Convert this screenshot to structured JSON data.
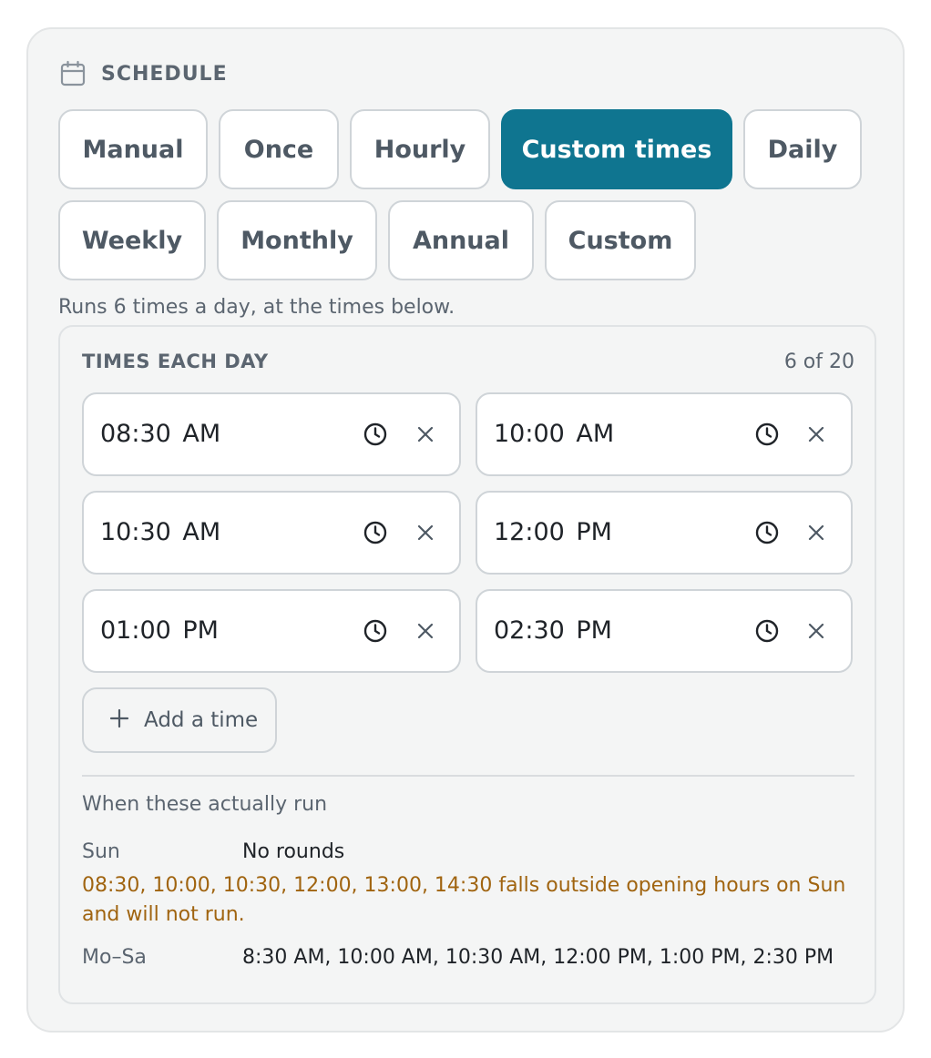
{
  "header": {
    "title": "SCHEDULE",
    "icon": "calendar-icon"
  },
  "frequency_options": [
    {
      "label": "Manual",
      "selected": false
    },
    {
      "label": "Once",
      "selected": false
    },
    {
      "label": "Hourly",
      "selected": false
    },
    {
      "label": "Custom times",
      "selected": true
    },
    {
      "label": "Daily",
      "selected": false
    },
    {
      "label": "Weekly",
      "selected": false
    },
    {
      "label": "Monthly",
      "selected": false
    },
    {
      "label": "Annual",
      "selected": false
    },
    {
      "label": "Custom",
      "selected": false
    }
  ],
  "summary": "Runs 6 times a day, at the times below.",
  "times_panel": {
    "title": "TIMES EACH DAY",
    "count": "6 of 20",
    "times": [
      "08:30 AM",
      "10:00 AM",
      "10:30 AM",
      "12:00 PM",
      "01:00 PM",
      "02:30 PM"
    ],
    "add_label": "Add a time"
  },
  "run_preview": {
    "title": "When these actually run",
    "rows": [
      {
        "label": "Sun",
        "value": "No rounds"
      },
      {
        "label": "Mo–Sa",
        "value": "8:30 AM, 10:00 AM, 10:30 AM, 12:00 PM, 1:00 PM, 2:30 PM"
      }
    ],
    "warning": "08:30, 10:00, 10:30, 12:00, 13:00, 14:30 falls outside opening hours on Sun and will not run."
  },
  "colors": {
    "accent": "#0f7590",
    "warning": "#a06410",
    "muted_text": "#5b6570"
  }
}
